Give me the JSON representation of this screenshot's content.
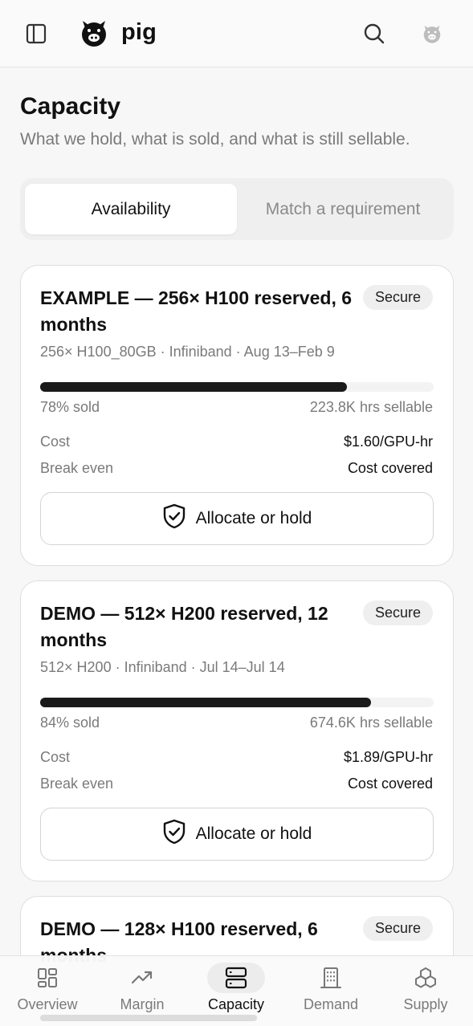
{
  "header": {
    "brand": "pig",
    "icons": [
      "sidebar-toggle-icon",
      "pig-logo-icon",
      "search-icon",
      "avatar-pig-icon"
    ]
  },
  "page": {
    "title": "Capacity",
    "subtitle": "What we hold, what is sold, and what is still sellable."
  },
  "tabs": [
    {
      "label": "Availability",
      "active": true
    },
    {
      "label": "Match a requirement",
      "active": false
    }
  ],
  "cards": [
    {
      "title": "EXAMPLE — 256× H100 reserved, 6 months",
      "badge": "Secure",
      "meta": "256× H100_80GB · Infiniband · Aug 13–Feb 9",
      "sold_fraction": 0.78,
      "sold_label": "78% sold",
      "sellable_label": "223.8K hrs sellable",
      "cost_label": "Cost",
      "cost_value": "$1.60/GPU-hr",
      "breakeven_label": "Break even",
      "breakeven_value": "Cost covered",
      "action_label": "Allocate or hold"
    },
    {
      "title": "DEMO — 512× H200 reserved, 12 months",
      "badge": "Secure",
      "meta": "512× H200 · Infiniband · Jul 14–Jul 14",
      "sold_fraction": 0.84,
      "sold_label": "84% sold",
      "sellable_label": "674.6K hrs sellable",
      "cost_label": "Cost",
      "cost_value": "$1.89/GPU-hr",
      "breakeven_label": "Break even",
      "breakeven_value": "Cost covered",
      "action_label": "Allocate or hold"
    },
    {
      "title": "DEMO — 128× H100 reserved, 6 months",
      "badge": "Secure"
    }
  ],
  "bottom_nav": [
    {
      "label": "Overview",
      "icon": "grid-icon",
      "active": false
    },
    {
      "label": "Margin",
      "icon": "trend-up-icon",
      "active": false
    },
    {
      "label": "Capacity",
      "icon": "server-icon",
      "active": true
    },
    {
      "label": "Demand",
      "icon": "building-icon",
      "active": false
    },
    {
      "label": "Supply",
      "icon": "boxes-icon",
      "active": false
    }
  ],
  "colors": {
    "background": "#f7f7f7",
    "card": "#ffffff",
    "bar_fill": "#1a1a1a",
    "muted_text": "#7a7a7a"
  }
}
